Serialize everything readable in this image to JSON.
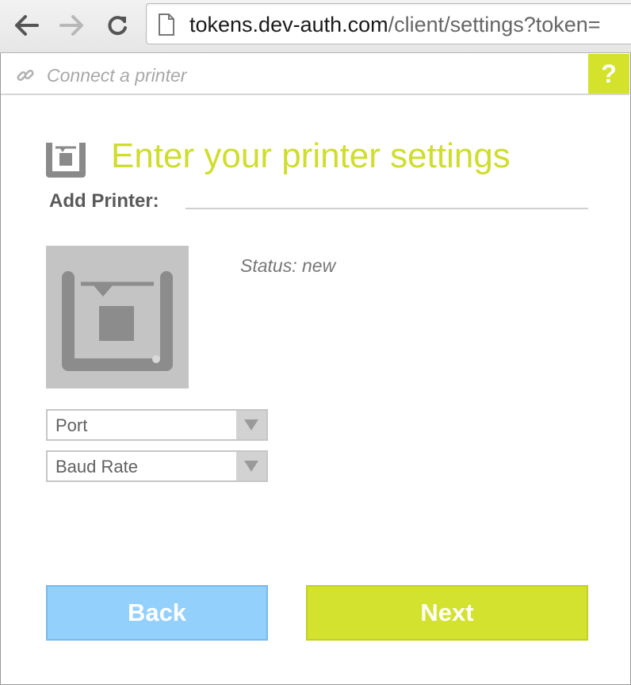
{
  "browser": {
    "url_host": "tokens.dev-auth.com",
    "url_path": "/client/settings?token="
  },
  "connect_bar": {
    "label": "Connect a printer",
    "help_label": "?"
  },
  "page": {
    "title": "Enter your printer settings",
    "section_label": "Add Printer:",
    "status": "Status: new"
  },
  "form": {
    "port": {
      "selected": "Port"
    },
    "baud_rate": {
      "selected": "Baud Rate"
    }
  },
  "buttons": {
    "back": "Back",
    "next": "Next"
  },
  "colors": {
    "accent": "#d3e22f",
    "back_button": "#93d0fc",
    "icon_gray": "#8a8a8a"
  }
}
